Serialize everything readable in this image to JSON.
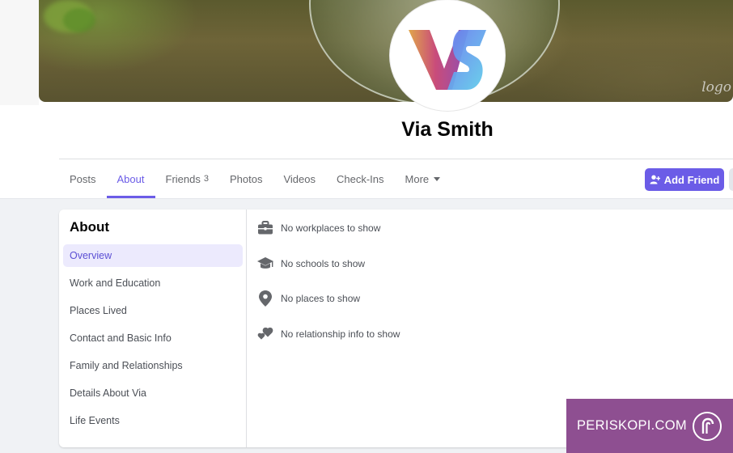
{
  "profile": {
    "name": "Via Smith",
    "cover_watermark": "logo"
  },
  "tabs": [
    {
      "label": "Posts",
      "active": false
    },
    {
      "label": "About",
      "active": true
    },
    {
      "label": "Friends",
      "count": "3",
      "active": false
    },
    {
      "label": "Photos",
      "active": false
    },
    {
      "label": "Videos",
      "active": false
    },
    {
      "label": "Check-Ins",
      "active": false
    },
    {
      "label": "More",
      "active": false
    }
  ],
  "actions": {
    "add_friend_label": "Add Friend"
  },
  "about": {
    "title": "About",
    "menu": [
      "Overview",
      "Work and Education",
      "Places Lived",
      "Contact and Basic Info",
      "Family and Relationships",
      "Details About Via",
      "Life Events"
    ],
    "active_menu": "Overview",
    "info": [
      {
        "icon": "briefcase-icon",
        "text": "No workplaces to show"
      },
      {
        "icon": "graduation-cap-icon",
        "text": "No schools to show"
      },
      {
        "icon": "map-pin-icon",
        "text": "No places to show"
      },
      {
        "icon": "hearts-icon",
        "text": "No relationship info to show"
      }
    ]
  },
  "watermark": {
    "text": "PERISKOPI.COM"
  },
  "colors": {
    "accent": "#6b5ce7",
    "active_menu_bg": "#eceafd",
    "watermark_bg": "#8e4f91"
  }
}
